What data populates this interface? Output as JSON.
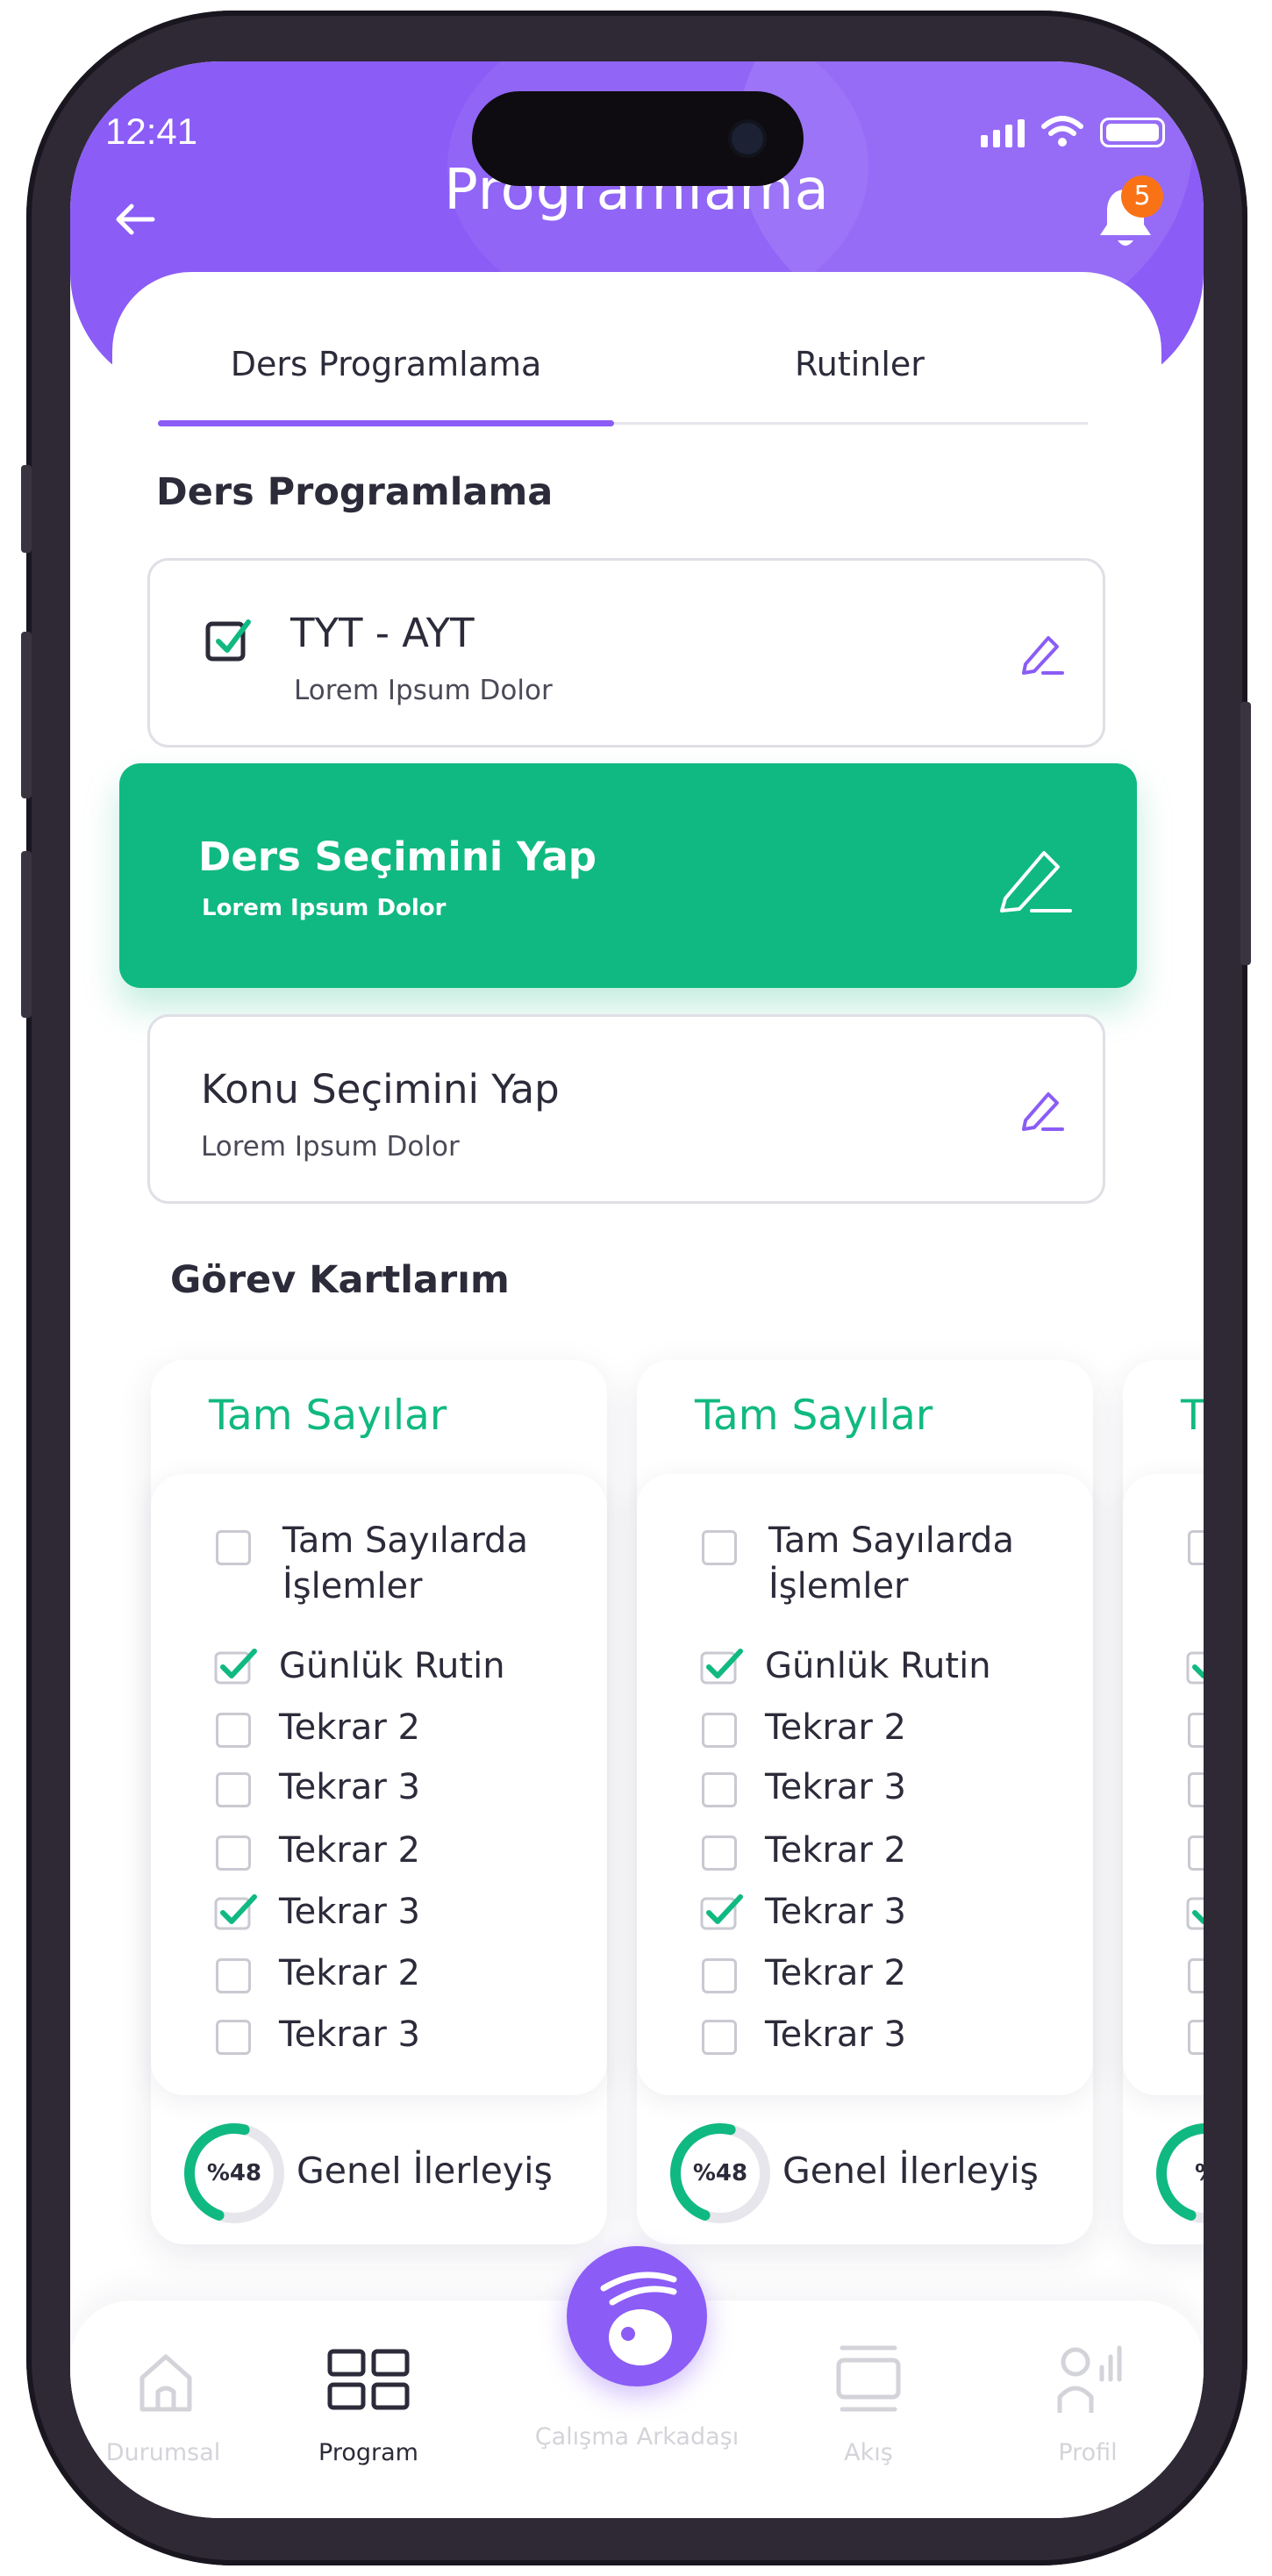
{
  "status_bar": {
    "time": "12:41"
  },
  "header": {
    "title": "Programlama",
    "notification_count": "5"
  },
  "tabs": [
    {
      "label": "Ders Programlama",
      "active": true
    },
    {
      "label": "Rutinler",
      "active": false
    }
  ],
  "section_program": {
    "title": "Ders Programlama"
  },
  "program_rows": [
    {
      "title": "TYT - AYT",
      "subtitle": "Lorem Ipsum Dolor",
      "checked": true
    },
    {
      "title": "Ders Seçimini Yap",
      "subtitle": "Lorem Ipsum Dolor",
      "highlighted": true
    },
    {
      "title": "Konu Seçimini Yap",
      "subtitle": "Lorem Ipsum Dolor"
    }
  ],
  "section_tasks": {
    "title": "Görev Kartlarım"
  },
  "task_cards": [
    {
      "title": "Tam Sayılar",
      "items": [
        {
          "label": "Tam Sayılarda İşlemler",
          "checked": false
        },
        {
          "label": "Günlük Rutin",
          "checked": true
        },
        {
          "label": "Tekrar 2",
          "checked": false
        },
        {
          "label": "Tekrar 3",
          "checked": false
        },
        {
          "label": "Tekrar 2",
          "checked": false
        },
        {
          "label": "Tekrar 3",
          "checked": true
        },
        {
          "label": "Tekrar 2",
          "checked": false
        },
        {
          "label": "Tekrar 3",
          "checked": false
        }
      ],
      "progress": {
        "label": "%48",
        "value": 0.48,
        "text": "Genel İlerleyiş"
      }
    },
    {
      "title": "Tam Sayılar",
      "items": [
        {
          "label": "Tam Sayılarda İşlemler",
          "checked": false
        },
        {
          "label": "Günlük Rutin",
          "checked": true
        },
        {
          "label": "Tekrar 2",
          "checked": false
        },
        {
          "label": "Tekrar 3",
          "checked": false
        },
        {
          "label": "Tekrar 2",
          "checked": false
        },
        {
          "label": "Tekrar 3",
          "checked": true
        },
        {
          "label": "Tekrar 2",
          "checked": false
        },
        {
          "label": "Tekrar 3",
          "checked": false
        }
      ],
      "progress": {
        "label": "%48",
        "value": 0.48,
        "text": "Genel İlerleyiş"
      }
    },
    {
      "title": "T",
      "items": [],
      "progress": {
        "label": "%",
        "value": 0.48,
        "text": ""
      }
    }
  ],
  "bottom_nav": [
    {
      "label": "Durumsal",
      "icon": "home-icon",
      "active": false
    },
    {
      "label": "Program",
      "icon": "grid-icon",
      "active": true
    },
    {
      "label": "Çalışma Arkadaşı",
      "icon": "study-buddy-icon",
      "active": false
    },
    {
      "label": "Akış",
      "icon": "feed-icon",
      "active": false
    },
    {
      "label": "Profil",
      "icon": "profile-icon",
      "active": false
    }
  ],
  "colors": {
    "primary": "#8b5cf6",
    "accent": "#10b981",
    "badge": "#f97316",
    "text": "#2b2b3a"
  }
}
